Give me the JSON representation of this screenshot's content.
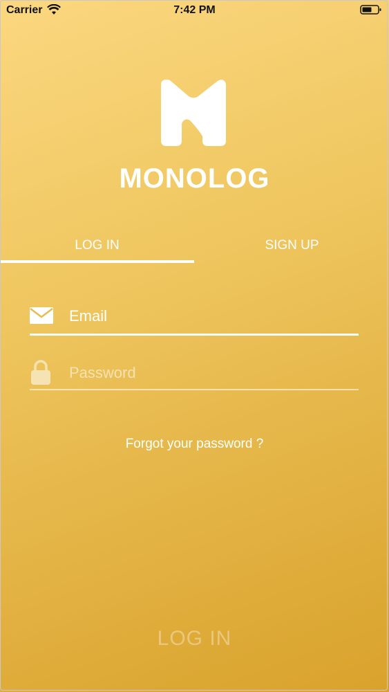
{
  "status_bar": {
    "carrier": "Carrier",
    "time": "7:42 PM"
  },
  "brand": {
    "name": "MONOLOG"
  },
  "tabs": [
    {
      "label": "LOG IN",
      "active": true
    },
    {
      "label": "SIGN UP",
      "active": false
    }
  ],
  "form": {
    "email_placeholder": "Email",
    "password_placeholder": "Password"
  },
  "forgot_password": "Forgot your password ?",
  "login_button": "LOG IN",
  "colors": {
    "accent": "#ffffff",
    "gradient_top": "#fbd77f",
    "gradient_bottom": "#d9a22c"
  }
}
